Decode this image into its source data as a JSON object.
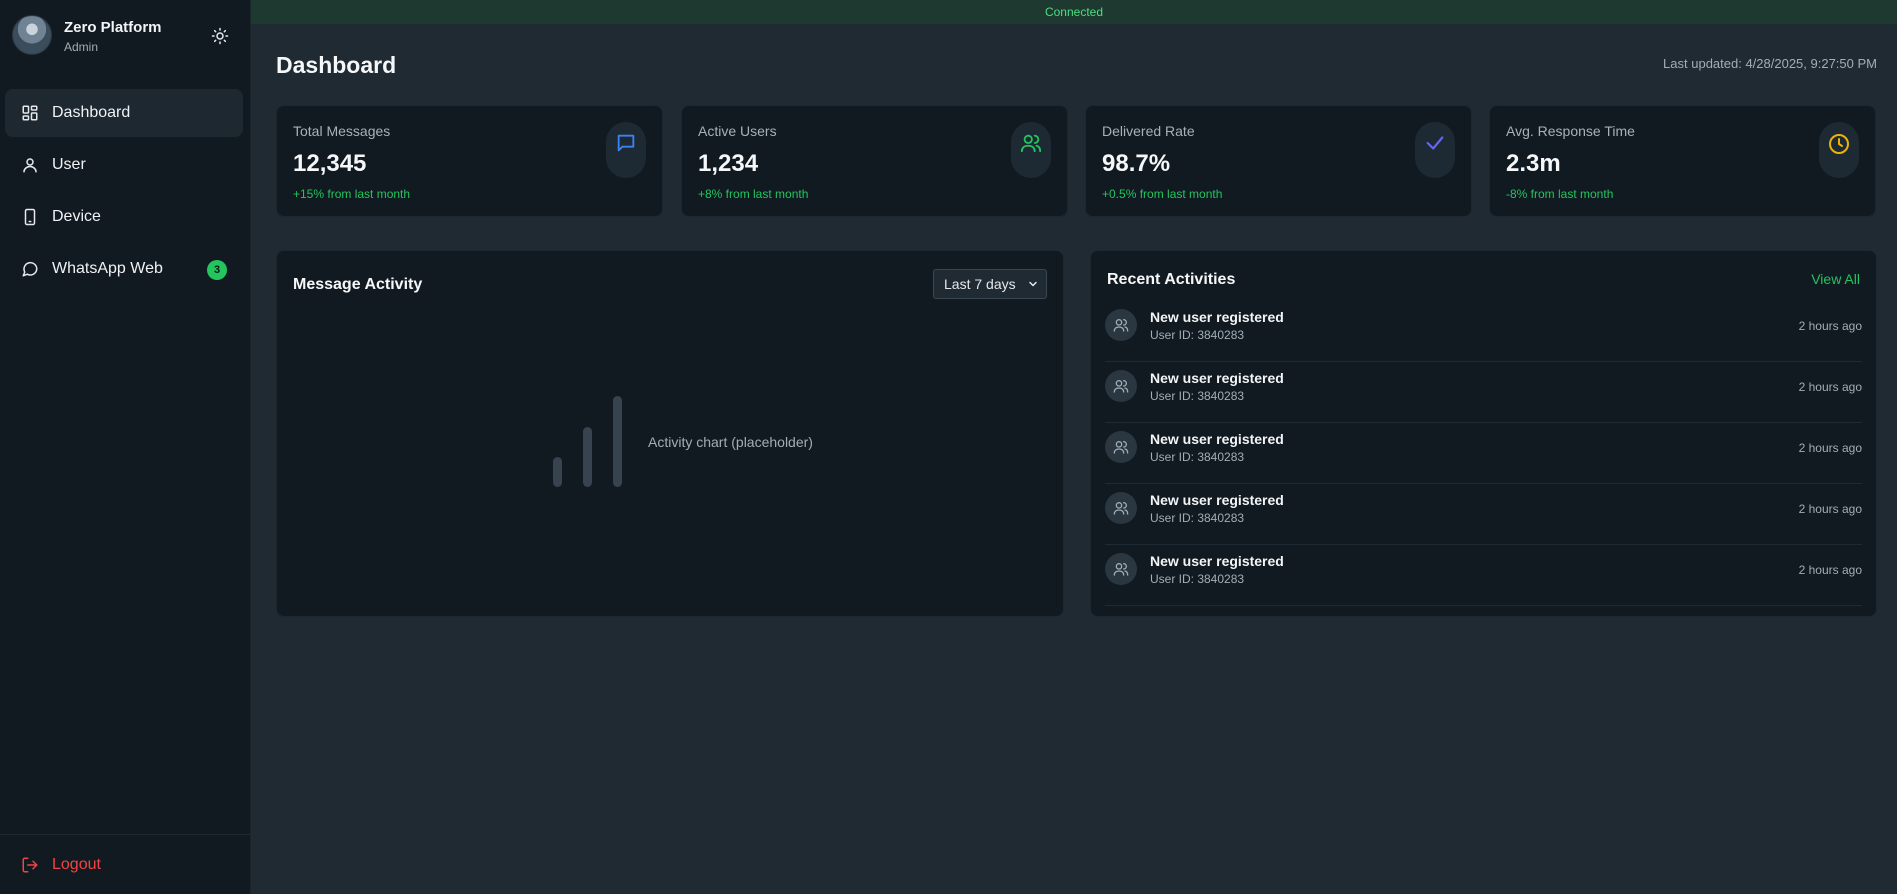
{
  "colors": {
    "accent_green": "#22c55e",
    "accent_blue": "#3b82f6",
    "accent_purple": "#6366f1",
    "accent_amber": "#eab308",
    "danger": "#ef4444",
    "sidebar_bg": "#111a21",
    "main_bg": "#1f2a32"
  },
  "profile": {
    "name": "Zero Platform",
    "role": "Admin",
    "avatar_icon": "user-avatar",
    "theme_icon": "sun-icon"
  },
  "sidebar": {
    "items": [
      {
        "label": "Dashboard",
        "icon": "dashboard-grid-icon",
        "active": true
      },
      {
        "label": "User",
        "icon": "user-icon",
        "active": false
      },
      {
        "label": "Device",
        "icon": "phone-device-icon",
        "active": false
      },
      {
        "label": "WhatsApp Web",
        "icon": "chat-bubble-icon",
        "active": false,
        "badge": "3"
      }
    ],
    "logout": {
      "label": "Logout",
      "icon": "logout-icon"
    }
  },
  "connection": {
    "status": "Connected"
  },
  "header": {
    "title": "Dashboard",
    "last_updated": "Last updated: 4/28/2025, 9:27:50 PM"
  },
  "stats": [
    {
      "label": "Total Messages",
      "value": "12,345",
      "change": "+15% from last month",
      "icon": "message-icon",
      "color": "#3b82f6"
    },
    {
      "label": "Active Users",
      "value": "1,234",
      "change": "+8% from last month",
      "icon": "users-icon",
      "color": "#22c55e"
    },
    {
      "label": "Delivered Rate",
      "value": "98.7%",
      "change": "+0.5% from last month",
      "icon": "check-icon",
      "color": "#6366f1"
    },
    {
      "label": "Avg. Response Time",
      "value": "2.3m",
      "change": "-8% from last month",
      "icon": "clock-icon",
      "color": "#eab308"
    }
  ],
  "message_activity": {
    "title": "Message Activity",
    "range": {
      "selected": "Last 7 days"
    },
    "chart_placeholder": "Activity chart (placeholder)",
    "placeholder_icon": "bar-chart-icon"
  },
  "recent_activities": {
    "title": "Recent Activities",
    "view_all": "View All",
    "items": [
      {
        "title": "New user registered",
        "subtitle": "User ID: 3840283",
        "time": "2 hours ago",
        "icon": "users-icon"
      },
      {
        "title": "New user registered",
        "subtitle": "User ID: 3840283",
        "time": "2 hours ago",
        "icon": "users-icon"
      },
      {
        "title": "New user registered",
        "subtitle": "User ID: 3840283",
        "time": "2 hours ago",
        "icon": "users-icon"
      },
      {
        "title": "New user registered",
        "subtitle": "User ID: 3840283",
        "time": "2 hours ago",
        "icon": "users-icon"
      },
      {
        "title": "New user registered",
        "subtitle": "User ID: 3840283",
        "time": "2 hours ago",
        "icon": "users-icon"
      }
    ]
  }
}
